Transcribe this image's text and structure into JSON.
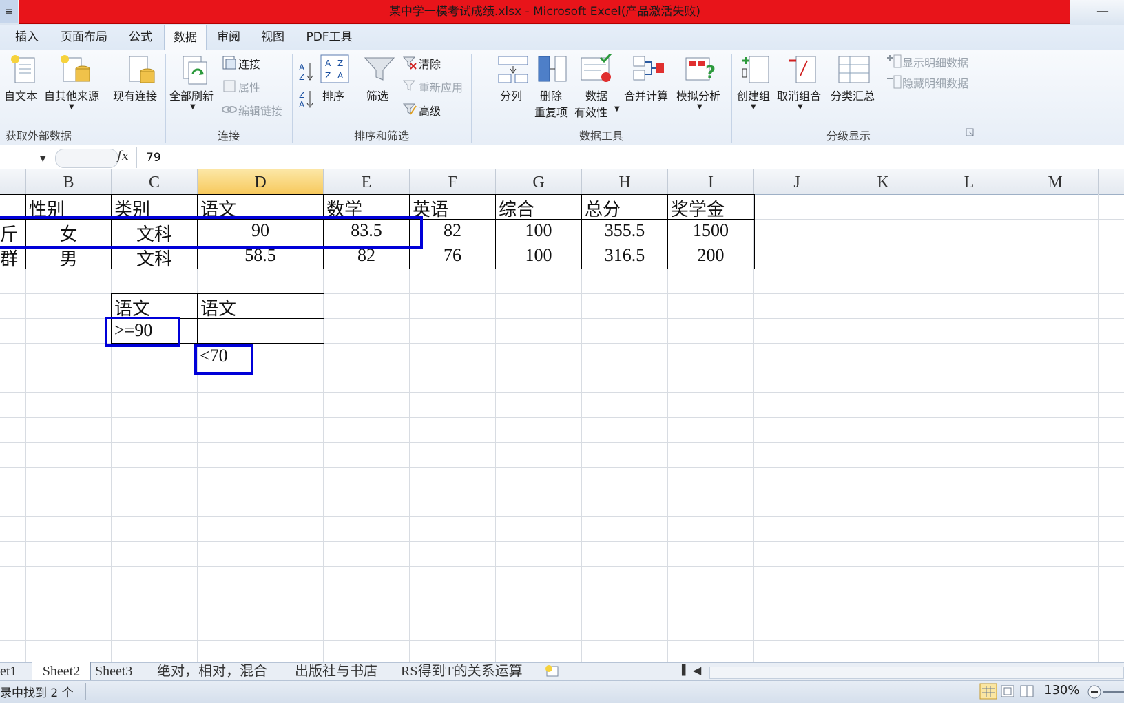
{
  "window": {
    "title": "某中学一模考试成绩.xlsx - Microsoft Excel(产品激活失败)",
    "qat_glyph": "≡",
    "minimize_glyph": "—"
  },
  "tabs": [
    "插入",
    "页面布局",
    "公式",
    "数据",
    "审阅",
    "视图",
    "PDF工具"
  ],
  "active_tab": "数据",
  "ribbon": {
    "groups": {
      "external": "获取外部数据",
      "connections": "连接",
      "sort_filter": "排序和筛选",
      "data_tools": "数据工具",
      "outline": "分级显示"
    },
    "buttons": {
      "from_text": "自文本",
      "other_sources": "自其他来源",
      "existing_conn": "现有连接",
      "refresh_all": "全部刷新",
      "connections": "连接",
      "properties": "属性",
      "edit_links": "编辑链接",
      "sort": "排序",
      "filter": "筛选",
      "clear": "清除",
      "reapply": "重新应用",
      "advanced": "高级",
      "text_to_columns": "分列",
      "remove_dup_1": "删除",
      "remove_dup_2": "重复项",
      "validation_1": "数据",
      "validation_2": "有效性",
      "consolidate": "合并计算",
      "whatif": "模拟分析",
      "group": "创建组",
      "ungroup": "取消组合",
      "subtotal": "分类汇总",
      "show_detail": "显示明细数据",
      "hide_detail": "隐藏明细数据"
    }
  },
  "formula_bar": {
    "fx": "fx",
    "value": "79"
  },
  "columns": [
    "B",
    "C",
    "D",
    "E",
    "F",
    "G",
    "H",
    "I",
    "J",
    "K",
    "L",
    "M"
  ],
  "selected_column": "D",
  "table": {
    "headers": [
      "性别",
      "类别",
      "语文",
      "数学",
      "英语",
      "综合",
      "总分",
      "奖学金"
    ],
    "rows": [
      {
        "a_partial": "斤",
        "cells": [
          "女",
          "文科",
          "90",
          "83.5",
          "82",
          "100",
          "355.5",
          "1500"
        ]
      },
      {
        "a_partial": "群",
        "cells": [
          "男",
          "文科",
          "58.5",
          "82",
          "76",
          "100",
          "316.5",
          "200"
        ]
      }
    ]
  },
  "criteria": {
    "h1": "语文",
    "h2": "语文",
    "c1": ">=90",
    "c2": "<70"
  },
  "sheets": [
    "et1",
    "Sheet2",
    "Sheet3",
    "绝对，相对，混合",
    "出版社与书店",
    "RS得到T的关系运算"
  ],
  "status": {
    "text": "录中找到 2 个",
    "zoom": "130%"
  }
}
